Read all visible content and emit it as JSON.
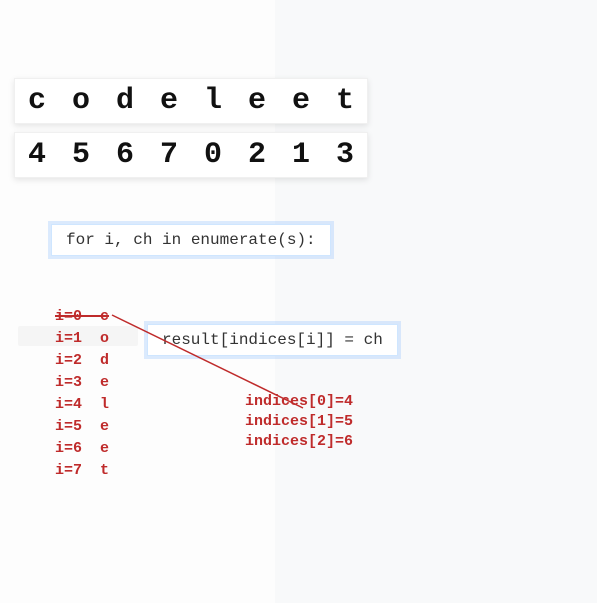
{
  "letters": [
    "c",
    "o",
    "d",
    "e",
    "l",
    "e",
    "e",
    "t"
  ],
  "indices": [
    "4",
    "5",
    "6",
    "7",
    "0",
    "2",
    "1",
    "3"
  ],
  "code": {
    "for_line": "for i, ch in enumerate(s):",
    "assign_line": "result[indices[i]] = ch"
  },
  "iterations": [
    {
      "label": "i=0  c",
      "struck": true
    },
    {
      "label": "i=1  o",
      "struck": false
    },
    {
      "label": "i=2  d",
      "struck": false
    },
    {
      "label": "i=3  e",
      "struck": false
    },
    {
      "label": "i=4  l",
      "struck": false
    },
    {
      "label": "i=5  e",
      "struck": false
    },
    {
      "label": "i=6  e",
      "struck": false
    },
    {
      "label": "i=7  t",
      "struck": false
    }
  ],
  "indices_resolved": [
    "indices[0]=4",
    "indices[1]=5",
    "indices[2]=6"
  ]
}
